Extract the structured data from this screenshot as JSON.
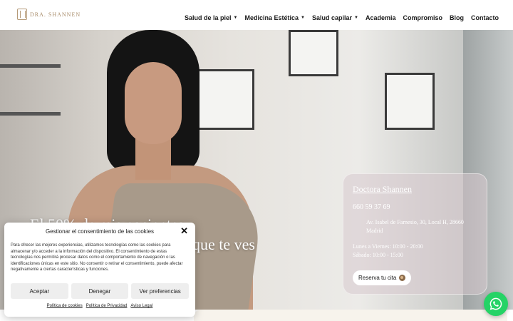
{
  "header": {
    "logo_text": "DRA. SHANNEN",
    "nav": [
      {
        "label": "Salud de la piel",
        "has_dropdown": true
      },
      {
        "label": "Medicina Estética",
        "has_dropdown": true
      },
      {
        "label": "Salud capilar",
        "has_dropdown": true
      },
      {
        "label": "Academia",
        "has_dropdown": false
      },
      {
        "label": "Compromiso",
        "has_dropdown": false
      },
      {
        "label": "Blog",
        "has_dropdown": false
      },
      {
        "label": "Contacto",
        "has_dropdown": false
      }
    ]
  },
  "hero": {
    "headline_line1": "El 50% de mis pacientes",
    "headline_line2": "que te ves"
  },
  "info_card": {
    "title": "Doctora Shannen",
    "phone": "660 59 37 69",
    "address": "Av. Isabel de Farnesio, 30, Local H, 28660 Madrid",
    "hours_line1": "Lunes a Viernes: 10:00 - 20:00",
    "hours_line2": "Sábado: 10:00 - 15:00",
    "button_label": "Reserva tu cita"
  },
  "cookie": {
    "title": "Gestionar el consentimiento de las cookies",
    "text": "Para ofrecer las mejores experiencias, utilizamos tecnologías como las cookies para almacenar y/o acceder a la información del dispositivo. El consentimiento de estas tecnologías nos permitirá procesar datos como el comportamiento de navegación o las identificaciones únicas en este sitio. No consentir o retirar el consentimiento, puede afectar negativamente a ciertas características y funciones.",
    "accept_label": "Aceptar",
    "deny_label": "Denegar",
    "preferences_label": "Ver preferencias",
    "links": [
      "Política de cookies",
      "Política de Privacidad",
      "Aviso Legal"
    ]
  },
  "colors": {
    "brand_gold": "#b59a78",
    "whatsapp_green": "#25d366"
  },
  "icons": {
    "close": "close-icon",
    "whatsapp": "whatsapp-icon",
    "dropdown": "chevron-down-icon",
    "location": "location-icon"
  }
}
